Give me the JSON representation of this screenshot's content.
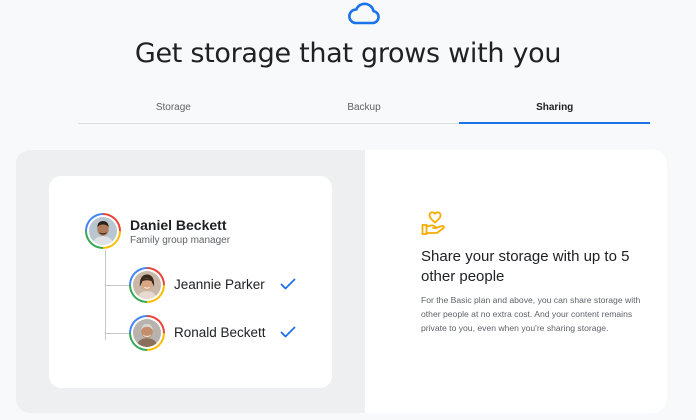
{
  "header": {
    "title": "Get storage that grows with you",
    "icon": "cloud-icon",
    "icon_color": "#1a73e8"
  },
  "tabs": [
    {
      "label": "Storage",
      "active": false
    },
    {
      "label": "Backup",
      "active": false
    },
    {
      "label": "Sharing",
      "active": true
    }
  ],
  "family": {
    "manager": {
      "name": "Daniel Beckett",
      "role": "Family group manager"
    },
    "members": [
      {
        "name": "Jeannie Parker",
        "status_icon": "checkmark-icon"
      },
      {
        "name": "Ronald Beckett",
        "status_icon": "checkmark-icon"
      }
    ]
  },
  "sharing": {
    "icon": "hand-heart-icon",
    "icon_color": "#f9ab00",
    "title": "Share your storage with up to 5 other people",
    "description": "For the Basic plan and above, you can share storage with other people at no extra cost. And your content remains private to you, even when you're sharing storage."
  },
  "colors": {
    "accent": "#1a73e8",
    "check": "#1a73e8"
  }
}
